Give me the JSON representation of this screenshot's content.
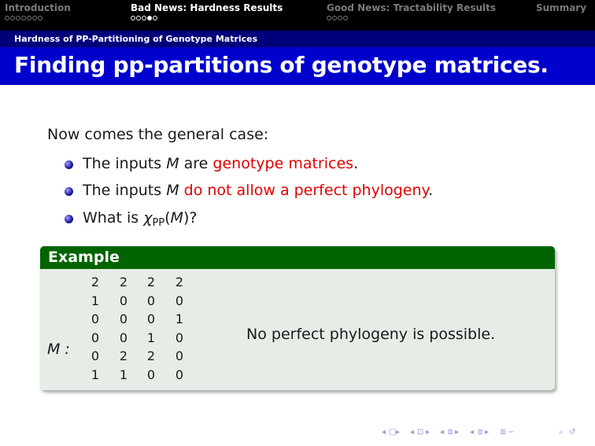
{
  "nav": {
    "sections": [
      {
        "label": "Introduction",
        "dots": 7,
        "current": -1,
        "active": false
      },
      {
        "label": "Bad News: Hardness Results",
        "dots": 5,
        "current": 3,
        "active": true
      },
      {
        "label": "Good News: Tractability Results",
        "dots": 4,
        "current": -1,
        "active": false
      },
      {
        "label": "Summary",
        "dots": 0,
        "current": -1,
        "active": false
      }
    ]
  },
  "subsection": "Hardness of PP-Partitioning of Genotype Matrices",
  "frame_title": "Finding pp-partitions of genotype matrices.",
  "lead": "Now comes the general case:",
  "bullets": [
    {
      "pre": "The inputs ",
      "var": "M",
      "mid": " are ",
      "highlight": "genotype matrices",
      "post": "."
    },
    {
      "pre": "The inputs ",
      "var": "M",
      "mid": " ",
      "highlight": "do not allow a perfect phylogeny",
      "post": "."
    },
    {
      "pre": "What is ",
      "chi": "χ",
      "sub": "PP",
      "post_open": "(",
      "var": "M",
      "post_close": ")?"
    }
  ],
  "example": {
    "title": "Example",
    "matrix_label": "M :",
    "matrix": [
      [
        "2",
        "2",
        "2",
        "2"
      ],
      [
        "1",
        "0",
        "0",
        "0"
      ],
      [
        "0",
        "0",
        "0",
        "1"
      ],
      [
        "0",
        "0",
        "1",
        "0"
      ],
      [
        "0",
        "2",
        "2",
        "0"
      ],
      [
        "1",
        "1",
        "0",
        "0"
      ]
    ],
    "note": "No perfect phylogeny is possible."
  },
  "colors": {
    "highlight": "#e00000",
    "title_bar": "#0000cc",
    "subsection_bar": "#00007a",
    "block_head": "#006400",
    "block_body": "#e6ece6"
  },
  "footer_nav": [
    "◂",
    "□",
    "▸",
    "◂",
    "⊡",
    "▸",
    "◂",
    "≣",
    "▸",
    "◂",
    "≣",
    "▸",
    "≣",
    "∽",
    "⌕",
    "↺"
  ]
}
